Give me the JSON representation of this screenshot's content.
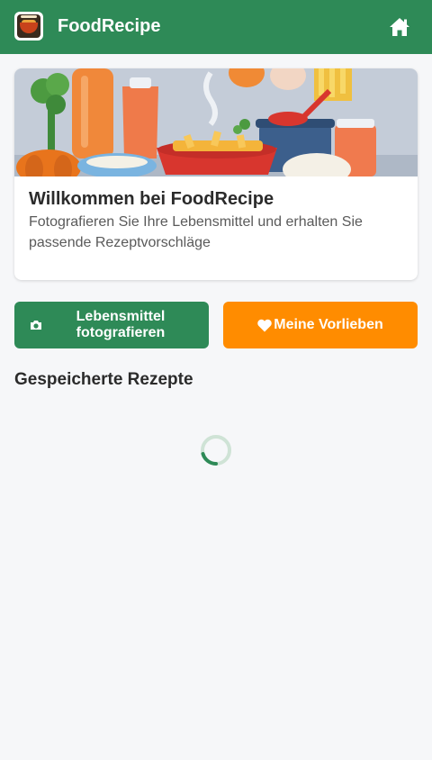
{
  "header": {
    "title": "FoodRecipe",
    "logo_icon": "foodrecipe-logo-icon",
    "home_icon": "home-icon"
  },
  "welcome": {
    "title": "Willkommen bei FoodRecipe",
    "subtitle": "Fotografieren Sie Ihre Lebensmittel und erhalten Sie passende Rezeptvorschläge"
  },
  "actions": {
    "photo_label": "Lebensmittel fotografieren",
    "photo_icon": "camera-icon",
    "fav_label": "Meine Vorlieben",
    "fav_icon": "heart-icon"
  },
  "saved": {
    "title": "Gespeicherte Rezepte",
    "loading_icon": "loading-spinner-icon"
  },
  "colors": {
    "primary": "#2e8a57",
    "accent": "#ff8c00",
    "background": "#f6f7f9"
  }
}
